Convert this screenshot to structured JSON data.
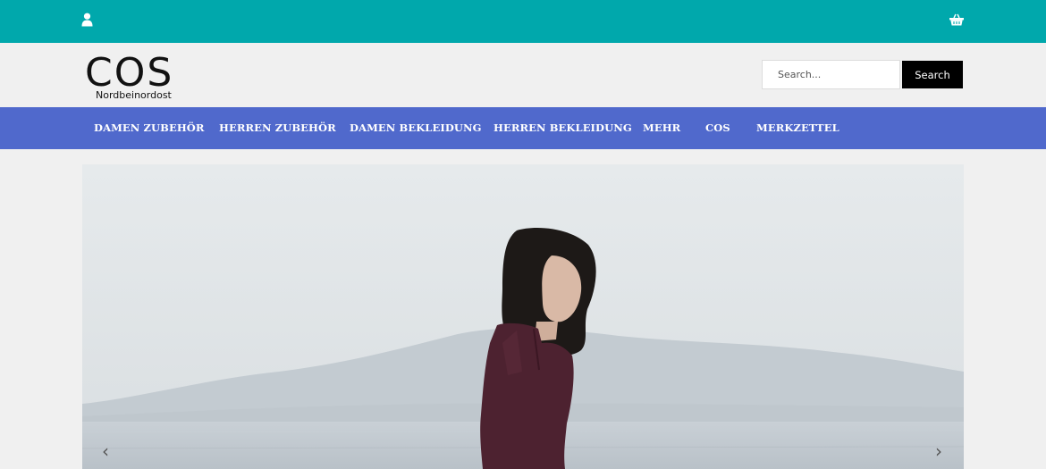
{
  "colors": {
    "topbar": "#00a8ac",
    "nav": "#5069cc",
    "search_button": "#000000",
    "page_background": "#f0f0f0"
  },
  "topbar": {
    "left_icon": "user-icon",
    "right_icon": "basket-icon"
  },
  "logo": {
    "wordmark": "COS",
    "subtitle": "Nordbeinordost"
  },
  "search": {
    "placeholder": "Search...",
    "value": "",
    "button_label": "Search",
    "icon": "search-button"
  },
  "nav": {
    "items": [
      {
        "label": "DAMEN ZUBEHÖR"
      },
      {
        "label": "HERREN ZUBEHÖR"
      },
      {
        "label": "DAMEN BEKLEIDUNG"
      },
      {
        "label": "HERREN BEKLEIDUNG"
      },
      {
        "label": "MEHR"
      },
      {
        "label": "COS"
      },
      {
        "label": "MERKZETTEL"
      }
    ]
  },
  "slider": {
    "prev_glyph": "‹",
    "next_glyph": "›",
    "prev_icon": "chevron-left-icon",
    "next_icon": "chevron-right-icon"
  }
}
